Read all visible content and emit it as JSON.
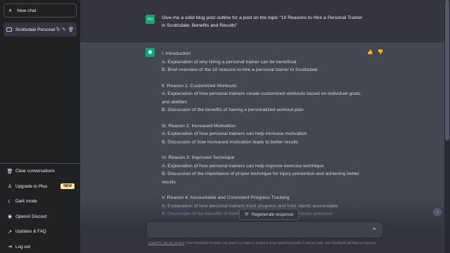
{
  "sidebar": {
    "new_chat_label": "New chat",
    "conversation_title": "Scottsdale Personal Trai",
    "bottom_items": [
      {
        "label": "Clear conversations",
        "icon": "trash-icon"
      },
      {
        "label": "Upgrade to Plus",
        "icon": "user-icon",
        "badge": "NEW"
      },
      {
        "label": "Dark mode",
        "icon": "moon-icon"
      },
      {
        "label": "OpenAI Discord",
        "icon": "discord-icon"
      },
      {
        "label": "Updates & FAQ",
        "icon": "external-link-icon"
      },
      {
        "label": "Log out",
        "icon": "logout-icon"
      }
    ]
  },
  "user_message": {
    "avatar_initials": "PU",
    "text": "Give me a solid blog post outline for a post on the topic \"10 Reasons to Hire a Personal Trainer in Scottsdale: Benefits and Results\""
  },
  "assistant_message": {
    "lines": [
      "I. Introduction",
      "A. Explanation of why hiring a personal trainer can be beneficial",
      "B. Brief overview of the 10 reasons to hire a personal trainer in Scottsdale",
      "",
      "II. Reason 1: Customized Workouts",
      "A. Explanation of how personal trainers create customized workouts based on individual goals and abilities",
      "B. Discussion of the benefits of having a personalized workout plan",
      "",
      "III. Reason 2: Increased Motivation",
      "A. Explanation of how personal trainers can help increase motivation",
      "B. Discussion of how increased motivation leads to better results",
      "",
      "IV. Reason 3: Improved Technique",
      "A. Explanation of how personal trainers can help improve exercise technique",
      "B. Discussion of the importance of proper technique for injury prevention and achieving better results",
      "",
      "V. Reason 4: Accountable and Consistent Progress Tracking",
      "A. Explanation of how personal trainers track progress and hold clients accountable",
      "B. Discussion of the benefits of having consistent progress and provide guidance"
    ]
  },
  "regenerate_label": "Regenerate response",
  "input": {
    "placeholder": ""
  },
  "footer": {
    "link_text": "ChatGPT Jan 30 Version",
    "text": ". Free Research Preview. Our goal is to make AI systems more natural and safe to interact with. Your feedback will help us improve."
  },
  "colors": {
    "sidebar": "#202123",
    "main": "#343541",
    "assistant_row": "#444654",
    "accent": "#10a37f"
  }
}
